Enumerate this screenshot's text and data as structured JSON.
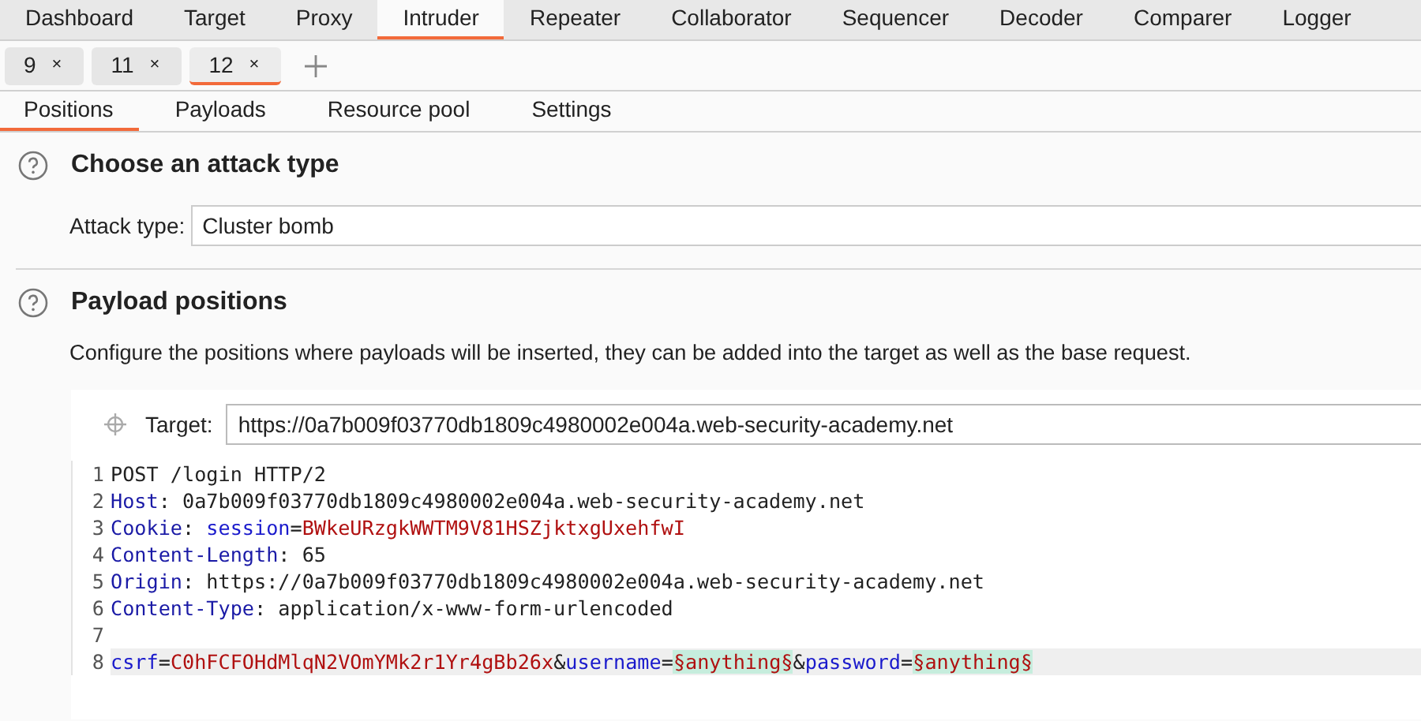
{
  "main_tabs": [
    {
      "label": "Dashboard",
      "selected": false
    },
    {
      "label": "Target",
      "selected": false
    },
    {
      "label": "Proxy",
      "selected": false
    },
    {
      "label": "Intruder",
      "selected": true
    },
    {
      "label": "Repeater",
      "selected": false
    },
    {
      "label": "Collaborator",
      "selected": false
    },
    {
      "label": "Sequencer",
      "selected": false
    },
    {
      "label": "Decoder",
      "selected": false
    },
    {
      "label": "Comparer",
      "selected": false
    },
    {
      "label": "Logger",
      "selected": false
    }
  ],
  "request_tabs": [
    {
      "label": "9",
      "close": "×",
      "selected": false
    },
    {
      "label": "11",
      "close": "×",
      "selected": false
    },
    {
      "label": "12",
      "close": "×",
      "selected": true
    }
  ],
  "sub_tabs": [
    {
      "label": "Positions",
      "selected": true
    },
    {
      "label": "Payloads",
      "selected": false
    },
    {
      "label": "Resource pool",
      "selected": false
    },
    {
      "label": "Settings",
      "selected": false
    }
  ],
  "attack_section": {
    "title": "Choose an attack type",
    "label": "Attack type:",
    "value": "Cluster bomb"
  },
  "positions_section": {
    "title": "Payload positions",
    "description": "Configure the positions where payloads will be inserted, they can be added into the target as well as the base request.",
    "target_label": "Target:",
    "target_value": "https://0a7b009f03770db1809c4980002e004a.web-security-academy.net"
  },
  "editor": {
    "lines": [
      {
        "number": "1",
        "highlighted": false,
        "tokens": [
          {
            "text": "POST /login HTTP/2",
            "kind": "plain"
          }
        ]
      },
      {
        "number": "2",
        "highlighted": false,
        "tokens": [
          {
            "text": "Host",
            "kind": "key"
          },
          {
            "text": ": 0a7b009f03770db1809c4980002e004a.web-security-academy.net",
            "kind": "plain"
          }
        ]
      },
      {
        "number": "3",
        "highlighted": false,
        "tokens": [
          {
            "text": "Cookie",
            "kind": "key"
          },
          {
            "text": ": ",
            "kind": "plain"
          },
          {
            "text": "session",
            "kind": "param"
          },
          {
            "text": "=",
            "kind": "plain"
          },
          {
            "text": "BWkeURzgkWWTM9V81HSZjktxgUxehfwI",
            "kind": "value"
          }
        ]
      },
      {
        "number": "4",
        "highlighted": false,
        "tokens": [
          {
            "text": "Content-Length",
            "kind": "key"
          },
          {
            "text": ": 65",
            "kind": "plain"
          }
        ]
      },
      {
        "number": "5",
        "highlighted": false,
        "tokens": [
          {
            "text": "Origin",
            "kind": "key"
          },
          {
            "text": ": https://0a7b009f03770db1809c4980002e004a.web-security-academy.net",
            "kind": "plain"
          }
        ]
      },
      {
        "number": "6",
        "highlighted": false,
        "tokens": [
          {
            "text": "Content-Type",
            "kind": "key"
          },
          {
            "text": ": application/x-www-form-urlencoded",
            "kind": "plain"
          }
        ]
      },
      {
        "number": "7",
        "highlighted": false
      },
      {
        "number": "8",
        "highlighted": true,
        "tokens": [
          {
            "text": "csrf",
            "kind": "param"
          },
          {
            "text": "=",
            "kind": "plain"
          },
          {
            "text": "C0hFCFOHdMlqN2VOmYMk2r1Yr4gBb26x",
            "kind": "value"
          },
          {
            "text": "&",
            "kind": "plain"
          },
          {
            "text": "username",
            "kind": "param"
          },
          {
            "text": "=",
            "kind": "plain"
          },
          {
            "text": "§anything§",
            "kind": "marker"
          },
          {
            "text": "&",
            "kind": "plain"
          },
          {
            "text": "password",
            "kind": "param"
          },
          {
            "text": "=",
            "kind": "plain"
          },
          {
            "text": "§anything§",
            "kind": "marker"
          }
        ]
      }
    ]
  }
}
